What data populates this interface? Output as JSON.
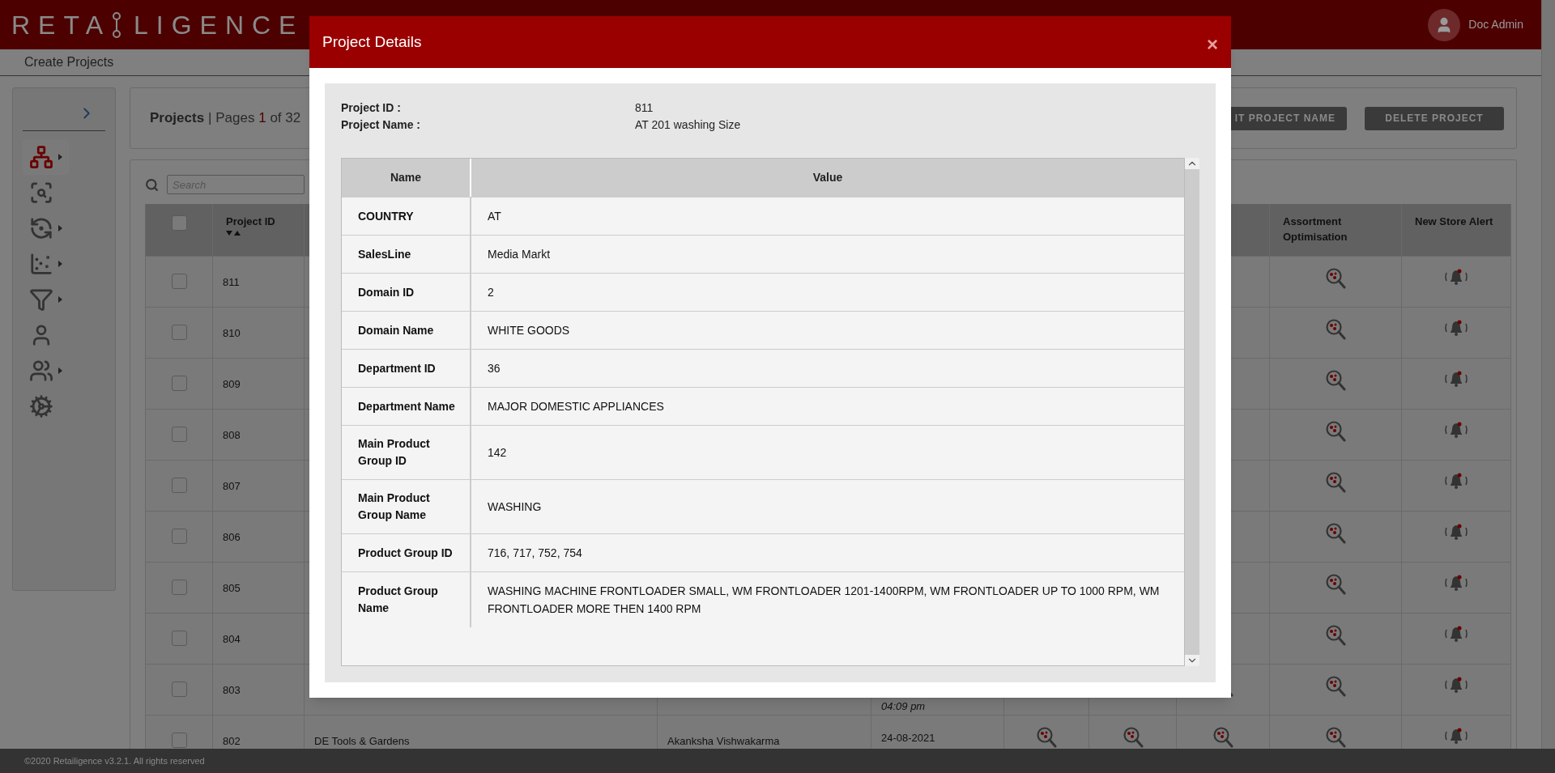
{
  "header": {
    "logo_parts": [
      "RETA",
      "LIGENCE"
    ],
    "user_name": "Doc Admin"
  },
  "breadcrumb": "Create Projects",
  "sidebar": {
    "items": [
      {
        "selected": true,
        "submenu": true
      },
      {
        "selected": false,
        "submenu": false
      },
      {
        "selected": false,
        "submenu": true
      },
      {
        "selected": false,
        "submenu": true
      },
      {
        "selected": false,
        "submenu": true
      },
      {
        "selected": false,
        "submenu": false
      },
      {
        "selected": false,
        "submenu": true
      },
      {
        "selected": false,
        "submenu": false
      }
    ]
  },
  "projects_bar": {
    "title": "Projects",
    "pages_prefix": "| Pages",
    "page": "1",
    "pages_suffix": "of 32",
    "buttons": [
      "IT PROJECT NAME",
      "DELETE PROJECT"
    ]
  },
  "search": {
    "placeholder": "Search"
  },
  "table": {
    "header_checked": false,
    "columns": [
      {
        "label": "Project ID",
        "sortable": true
      },
      {
        "label": "Assortment Optimisation",
        "sortable": false
      },
      {
        "label": "New Store Alert",
        "sortable": false
      }
    ],
    "rows": [
      {
        "checked": false,
        "project_id": "811"
      },
      {
        "checked": false,
        "project_id": "810"
      },
      {
        "checked": false,
        "project_id": "809"
      },
      {
        "checked": false,
        "project_id": "808"
      },
      {
        "checked": false,
        "project_id": "807"
      },
      {
        "checked": false,
        "project_id": "806"
      },
      {
        "checked": false,
        "project_id": "805"
      },
      {
        "checked": false,
        "project_id": "804"
      },
      {
        "checked": false,
        "project_id": "803",
        "time": "04:09 pm"
      },
      {
        "checked": false,
        "project_id": "802",
        "name": "DE Tools & Gardens",
        "owner": "Akanksha Vishwakarma",
        "date": "24-08-2021"
      }
    ]
  },
  "footer": "©2020 Retailigence v3.2.1. All rights reserved",
  "modal": {
    "title": "Project Details",
    "close": "×",
    "info": [
      {
        "label": "Project ID :",
        "value": "811"
      },
      {
        "label": "Project Name :",
        "value": "AT 201 washing Size"
      }
    ],
    "columns": [
      "Name",
      "Value"
    ],
    "rows": [
      {
        "name": "COUNTRY",
        "value": "AT"
      },
      {
        "name": "SalesLine",
        "value": "Media Markt"
      },
      {
        "name": "Domain ID",
        "value": "2"
      },
      {
        "name": "Domain Name",
        "value": "WHITE GOODS"
      },
      {
        "name": "Department ID",
        "value": "36"
      },
      {
        "name": "Department Name",
        "value": "MAJOR DOMESTIC APPLIANCES"
      },
      {
        "name": "Main Product Group ID",
        "value": "142"
      },
      {
        "name": "Main Product Group Name",
        "value": "WASHING"
      },
      {
        "name": "Product Group ID",
        "value": "716, 717, 752, 754"
      },
      {
        "name": "Product Group Name",
        "value": "WASHING MACHINE FRONTLOADER SMALL, WM FRONTLOADER 1201-1400RPM, WM FRONTLOADER UP TO 1000 RPM, WM FRONTLOADER MORE THEN 1400 RPM"
      }
    ]
  }
}
